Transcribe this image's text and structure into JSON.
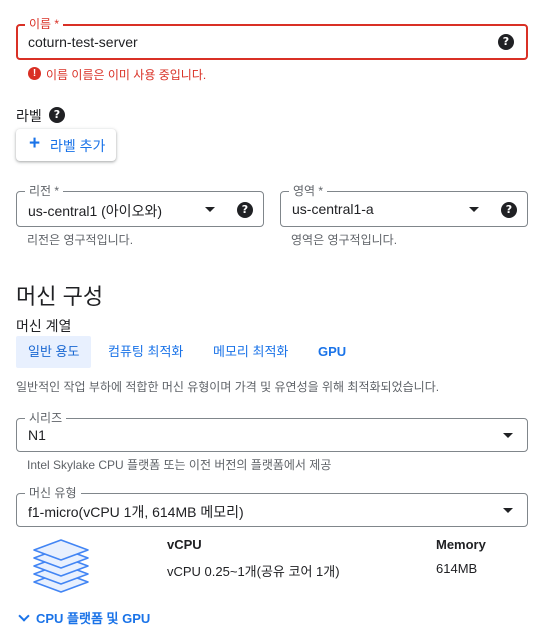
{
  "name_field": {
    "label": "이름 *",
    "value": "coturn-test-server",
    "error": "이름 이름은 이미 사용 중입니다."
  },
  "labels": {
    "title": "라벨",
    "add_button": "라벨 추가"
  },
  "region_field": {
    "label": "리전 *",
    "value": "us-central1 (아이오와)",
    "hint": "리전은 영구적입니다."
  },
  "zone_field": {
    "label": "영역 *",
    "value": "us-central1-a",
    "hint": "영역은 영구적입니다."
  },
  "machine_config": {
    "title": "머신 구성",
    "family_label": "머신 계열",
    "tabs": [
      {
        "label": "일반 용도",
        "active": true
      },
      {
        "label": "컴퓨팅 최적화",
        "active": false
      },
      {
        "label": "메모리 최적화",
        "active": false
      },
      {
        "label": "GPU",
        "active": false
      }
    ],
    "description": "일반적인 작업 부하에 적합한 머신 유형이며 가격 및 유연성을 위해 최적화되었습니다.",
    "series_field": {
      "label": "시리즈",
      "value": "N1",
      "hint": "Intel Skylake CPU 플랫폼 또는 이전 버전의 플랫폼에서 제공"
    },
    "type_field": {
      "label": "머신 유형",
      "value": "f1-micro(vCPU 1개, 614MB 메모리)"
    },
    "specs": {
      "vcpu_header": "vCPU",
      "memory_header": "Memory",
      "vcpu_value": "vCPU 0.25~1개(공유 코어 1개)",
      "memory_value": "614MB"
    },
    "expander": "CPU 플랫폼 및 GPU"
  },
  "colors": {
    "accent": "#1a73e8",
    "error": "#d93025",
    "text": "#202124",
    "secondary_text": "#5f6368",
    "active_tab_bg": "#e8f0fe"
  },
  "icons": {
    "help": "help-circle-icon",
    "error": "error-icon",
    "dropdown": "caret-down-icon",
    "add": "plus-icon",
    "machine": "stacked-layers-icon",
    "expand": "chevron-down-icon"
  }
}
